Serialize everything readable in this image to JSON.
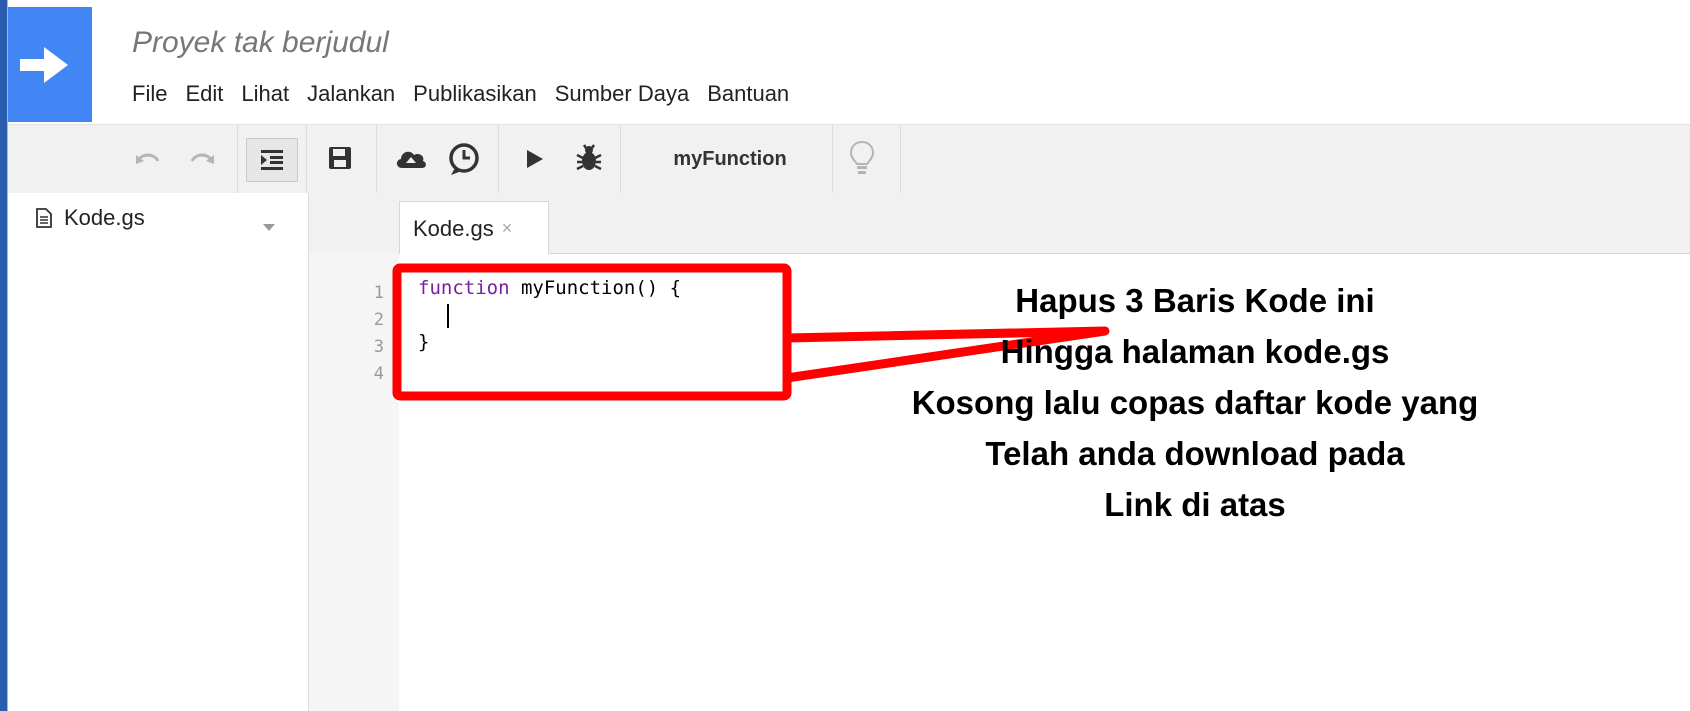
{
  "header": {
    "project_title": "Proyek tak berjudul",
    "logo_icon": "arrow-right-icon",
    "logo_color": "#4285f4"
  },
  "menu": [
    "File",
    "Edit",
    "Lihat",
    "Jalankan",
    "Publikasikan",
    "Sumber Daya",
    "Bantuan"
  ],
  "toolbar": {
    "icons": [
      "undo-icon",
      "redo-icon",
      "indent-icon",
      "save-icon",
      "cloud-icon",
      "clock-icon",
      "run-icon",
      "debug-icon",
      "lightbulb-icon"
    ],
    "function_select": "myFunction"
  },
  "sidebar": {
    "files": [
      {
        "name": "Kode.gs",
        "icon": "file-icon"
      }
    ]
  },
  "editor": {
    "tab_label": "Kode.gs",
    "tab_close": "×",
    "line_numbers": [
      "1",
      "2",
      "3",
      "4"
    ],
    "code_keyword": "function",
    "code_line1_rest": " myFunction() {",
    "code_line3": "}"
  },
  "annotation": {
    "color": "#ff0000",
    "lines": [
      "Hapus 3 Baris Kode ini",
      "Hingga halaman kode.gs",
      "Kosong lalu copas daftar kode yang",
      "Telah anda download pada",
      "Link di atas"
    ]
  }
}
